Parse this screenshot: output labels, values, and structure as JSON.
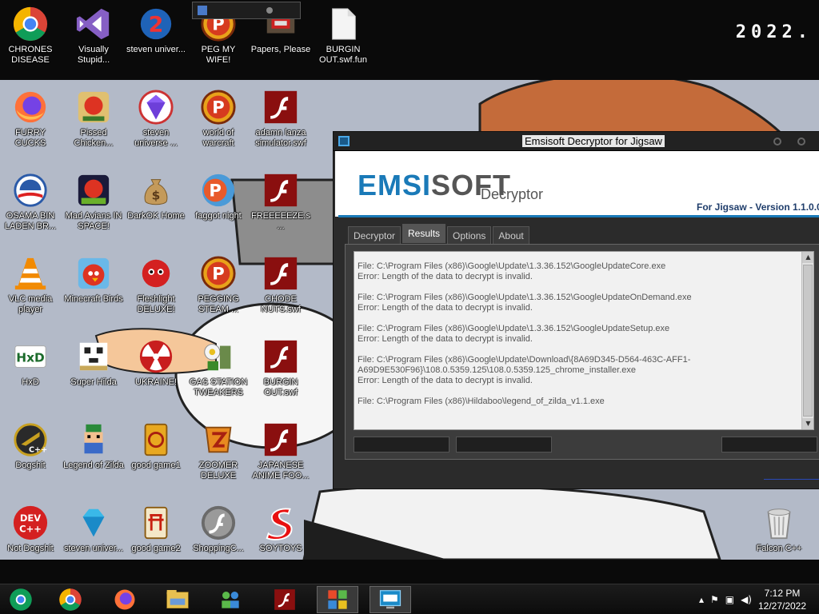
{
  "banner_text": "2022.",
  "desktop_icons": [
    {
      "label": "CHRONES DISEASE",
      "icon": "chrome-icon"
    },
    {
      "label": "Visually Stupid...",
      "icon": "visual-studio-icon"
    },
    {
      "label": "steven univer...",
      "icon": "steven-universe-icon"
    },
    {
      "label": "PEG MY WIFE!",
      "icon": "peggle-icon"
    },
    {
      "label": "Papers, Please",
      "icon": "papers-please-icon"
    },
    {
      "label": "BURGIN OUT.swf.fun",
      "icon": "file-icon"
    },
    {
      "label": "FURRY CUCKS",
      "icon": "firefox-icon"
    },
    {
      "label": "Pissed Chicken...",
      "icon": "angry-birds-seasons-icon"
    },
    {
      "label": "steven universe ...",
      "icon": "gem-icon"
    },
    {
      "label": "world of warcraft",
      "icon": "peggle-icon"
    },
    {
      "label": "adamn lanza simulator.swf",
      "icon": "flash-icon"
    },
    {
      "label": "OSAMA BIN LADEN BR...",
      "icon": "obama-logo-icon"
    },
    {
      "label": "Mad Avians IN SPACE!",
      "icon": "angry-birds-space-icon"
    },
    {
      "label": "DarkOK Home",
      "icon": "money-bag-icon"
    },
    {
      "label": "faggot night",
      "icon": "peggle-nights-icon"
    },
    {
      "label": "FREEEEEZE.s...",
      "icon": "flash-icon"
    },
    {
      "label": "VLC media player",
      "icon": "vlc-icon"
    },
    {
      "label": "Minecraft Birds",
      "icon": "angry-bird-icon"
    },
    {
      "label": "Fleshlight DELUXE!",
      "icon": "red-fuzzy-icon"
    },
    {
      "label": "PEGGING STEAM ...",
      "icon": "peggle-icon"
    },
    {
      "label": "CHODE NUTS.swf",
      "icon": "flash-icon"
    },
    {
      "label": "HxD",
      "icon": "hxd-icon"
    },
    {
      "label": "Super Hilda",
      "icon": "pixel-dog-icon"
    },
    {
      "label": "UKRAINE!",
      "icon": "radiation-icon"
    },
    {
      "label": "GAS STATION TWEAKERS",
      "icon": "plants-vs-zombies-icon"
    },
    {
      "label": "BURGIN OUT.swf",
      "icon": "flash-icon"
    },
    {
      "label": "Dogshit",
      "icon": "cpp-icon"
    },
    {
      "label": "Legend of Zilda",
      "icon": "pixel-hero-icon"
    },
    {
      "label": "good game1",
      "icon": "mahjong-icon"
    },
    {
      "label": "ZOOMER DELUXE",
      "icon": "zuma-icon"
    },
    {
      "label": "JAPANESE ANIME FOO...",
      "icon": "flash-icon"
    },
    {
      "label": "Not Dogshit",
      "icon": "dev-cpp-icon"
    },
    {
      "label": "steven univer...",
      "icon": "diamond-icon"
    },
    {
      "label": "good game2",
      "icon": "mahjong-icon"
    },
    {
      "label": "ShoppingC...",
      "icon": "flash-player-icon"
    },
    {
      "label": "SOYTOYS",
      "icon": "soytoys-icon"
    },
    {
      "label": "Falcon C++",
      "icon": "recycle-bin-icon"
    }
  ],
  "window": {
    "title": "Emsisoft Decryptor for Jigsaw",
    "brand_emsi": "EMSI",
    "brand_soft": "SOFT",
    "brand_product": "Decryptor",
    "version": "For Jigsaw - Version 1.1.0.0",
    "tabs": [
      {
        "label": "Decryptor"
      },
      {
        "label": "Results"
      },
      {
        "label": "Options"
      },
      {
        "label": "About"
      }
    ],
    "active_tab": "Results",
    "log": [
      {
        "file": "File: C:\\Program Files (x86)\\Google\\Update\\1.3.36.152\\GoogleUpdateCore.exe",
        "error": "Error: Length of the data to decrypt is invalid."
      },
      {
        "file": "File: C:\\Program Files (x86)\\Google\\Update\\1.3.36.152\\GoogleUpdateOnDemand.exe",
        "error": "Error: Length of the data to decrypt is invalid."
      },
      {
        "file": "File: C:\\Program Files (x86)\\Google\\Update\\1.3.36.152\\GoogleUpdateSetup.exe",
        "error": "Error: Length of the data to decrypt is invalid."
      },
      {
        "file": "File: C:\\Program Files (x86)\\Google\\Update\\Download\\{8A69D345-D564-463C-AFF1-A69D9E530F96}\\108.0.5359.125\\108.0.5359.125_chrome_installer.exe",
        "error": "Error: Length of the data to decrypt is invalid."
      },
      {
        "file": "File: C:\\Program Files (x86)\\Hildaboo\\legend_of_zilda_v1.1.exe",
        "error": ""
      }
    ]
  },
  "taskbar": {
    "items": [
      {
        "icon": "chrome-icon"
      },
      {
        "icon": "chrome-icon"
      },
      {
        "icon": "firefox-icon"
      },
      {
        "icon": "file-explorer-icon"
      },
      {
        "icon": "network-users-icon"
      },
      {
        "icon": "flash-icon"
      },
      {
        "icon": "app-window-icon"
      },
      {
        "icon": "decryptor-icon"
      }
    ],
    "clock_time": "7:12 PM",
    "clock_date": "12/27/2022"
  },
  "colors": {
    "emsisoft_blue": "#1a7ab8",
    "window_dark": "#2b2b2b",
    "taskbar": "#111111"
  }
}
